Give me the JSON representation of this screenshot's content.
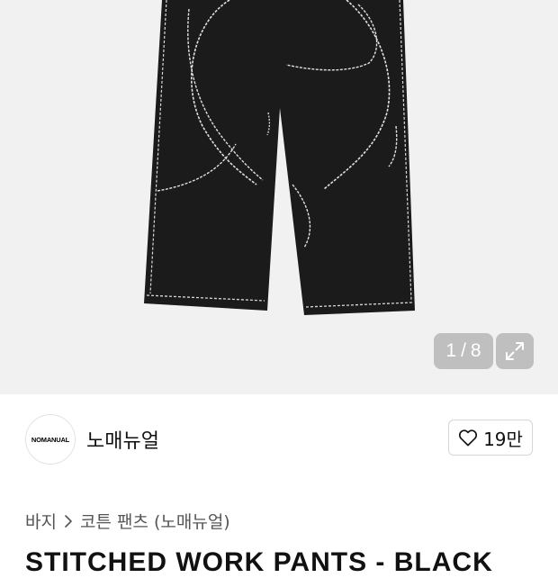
{
  "gallery": {
    "image_alt": "stitched black work pants",
    "current_index": "1",
    "separator": "/",
    "total": "8"
  },
  "brand": {
    "logo_text": "NOMANUAL",
    "name": "노매뉴얼"
  },
  "like": {
    "count": "19만"
  },
  "breadcrumb": {
    "items": [
      "바지",
      "코튼 팬츠 (노매뉴얼)"
    ]
  },
  "product": {
    "title": "STITCHED WORK PANTS - BLACK"
  },
  "icons": {
    "like": "heart-outline-icon",
    "zoom": "expand-icon",
    "breadcrumb_separator": "chevron-right-icon"
  },
  "colors": {
    "gallery_bg": "#f1f1f1",
    "pants": "#1b1b1c",
    "stitch": "#d9d9d9"
  }
}
